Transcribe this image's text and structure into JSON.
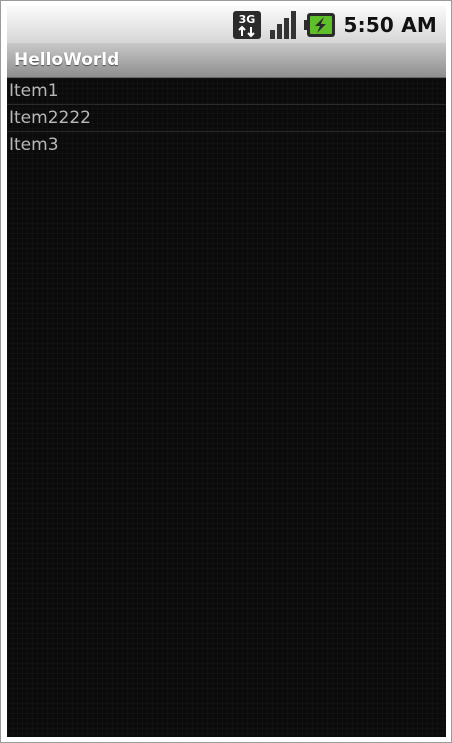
{
  "status_bar": {
    "network_label": "3G",
    "time": "5:50 AM",
    "icons": [
      "network-3g-icon",
      "signal-strength-icon",
      "battery-charging-icon"
    ]
  },
  "app": {
    "title": "HelloWorld"
  },
  "list": {
    "items": [
      {
        "label": "Item1"
      },
      {
        "label": "Item2222"
      },
      {
        "label": "Item3"
      }
    ]
  },
  "colors": {
    "background": "#0b0b0b",
    "list_text": "#b8b8b8",
    "battery_green": "#5fbf2a"
  }
}
